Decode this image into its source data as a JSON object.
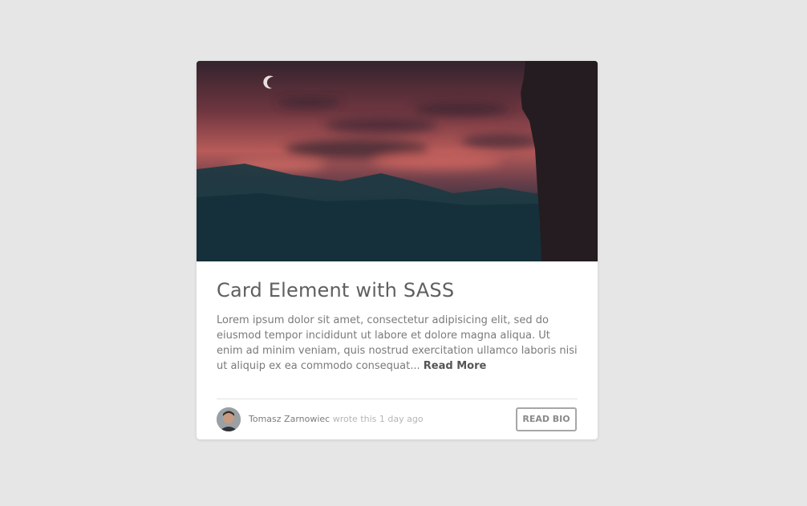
{
  "card": {
    "title": "Card Element with SASS",
    "text": "Lorem ipsum dolor sit amet, consectetur adipisicing elit, sed do eiusmod tempor incididunt ut labore et dolore magna aliqua. Ut enim ad minim veniam, quis nostrud exercitation ullamco laboris nisi ut aliquip ex ea commodo consequat...",
    "read_more": "Read More",
    "image_icon": "night-sky-photo",
    "author": {
      "name": "Tomasz Zarnowiec",
      "meta": "wrote this 1 day ago",
      "avatar_icon": "avatar-photo"
    },
    "bio_button": "READ BIO"
  },
  "colors": {
    "background": "#e6e6e6",
    "card": "#ffffff",
    "title": "#5f5f5f",
    "text": "#7a7a7a",
    "button_border": "#a7a7a7"
  }
}
